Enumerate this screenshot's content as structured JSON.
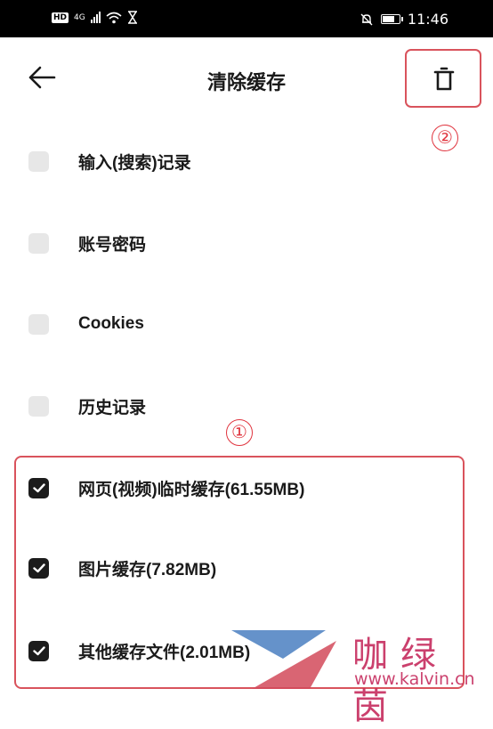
{
  "status_bar": {
    "hd": "HD",
    "network": "4G",
    "time": "11:46"
  },
  "header": {
    "title": "清除缓存",
    "back_icon": "arrow-left-icon",
    "delete_icon": "trash-icon"
  },
  "annotations": {
    "marker_1": "①",
    "marker_2": "②",
    "accent_color": "#d9535c"
  },
  "cache_items": [
    {
      "label": "输入(搜索)记录",
      "checked": false
    },
    {
      "label": "账号密码",
      "checked": false
    },
    {
      "label": "Cookies",
      "checked": false
    },
    {
      "label": "历史记录",
      "checked": false
    },
    {
      "label": "网页(视频)临时缓存(61.55MB)",
      "checked": true
    },
    {
      "label": "图片缓存(7.82MB)",
      "checked": true
    },
    {
      "label": "其他缓存文件(2.01MB)",
      "checked": true
    }
  ],
  "watermark": {
    "name": "咖绿茵",
    "url": "www.kalvin.cn"
  }
}
